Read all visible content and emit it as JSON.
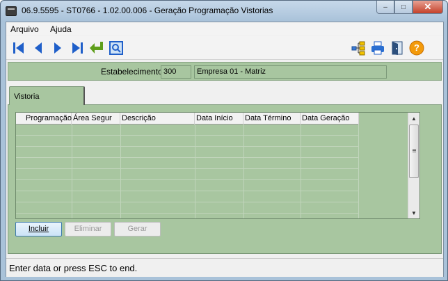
{
  "window": {
    "title": "06.9.5595 - ST0766 - 1.02.00.006 - Geração Programação Vistorias",
    "minimize_glyph": "–",
    "maximize_glyph": "□",
    "close_glyph": "✕"
  },
  "menu": {
    "items": [
      {
        "label": "Arquivo"
      },
      {
        "label": "Ajuda"
      }
    ]
  },
  "toolbar": {
    "icons": [
      "first-record-icon",
      "previous-record-icon",
      "next-record-icon",
      "last-record-icon",
      "return-icon",
      "zoom-search-icon",
      "hierarchy-icon",
      "print-icon",
      "exit-door-icon",
      "help-icon"
    ],
    "help_glyph": "?",
    "accent_blue": "#1f5fc9",
    "accent_green": "#5e9e1a",
    "accent_help": "#f39a0b"
  },
  "estabelecimento": {
    "label": "Estabelecimento:",
    "code": "300",
    "name": "Empresa 01 - Matriz"
  },
  "tabs": [
    {
      "label": "Vistoria"
    }
  ],
  "grid": {
    "columns": [
      "Programação",
      "Área Segur",
      "Descrição",
      "Data Início",
      "Data Término",
      "Data Geração"
    ],
    "rows": []
  },
  "buttons": {
    "incluir": "Incluir",
    "eliminar": "Eliminar",
    "gerar": "Gerar"
  },
  "status": {
    "text": "Enter data or press ESC to end."
  },
  "colors": {
    "panel_green": "#a8c6a0",
    "frame_blue": "#a9c2d9"
  }
}
